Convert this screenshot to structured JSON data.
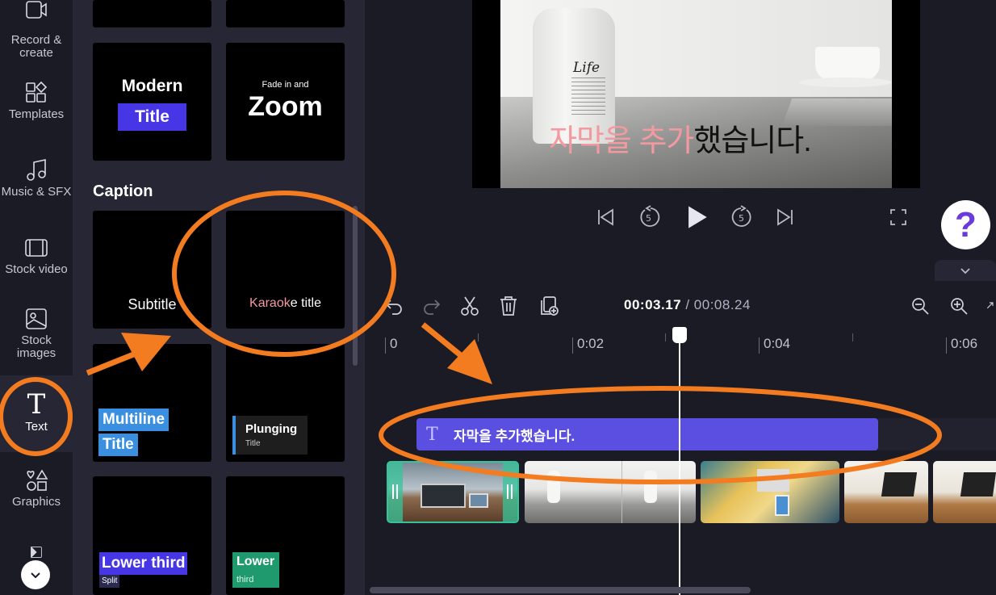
{
  "rail": {
    "items": [
      {
        "label": "Record &\ncreate",
        "icon": "record-icon"
      },
      {
        "label": "Templates",
        "icon": "templates-icon"
      },
      {
        "label": "Music & SFX",
        "icon": "music-icon"
      },
      {
        "label": "Stock video",
        "icon": "film-icon"
      },
      {
        "label": "Stock\nimages",
        "icon": "image-icon"
      },
      {
        "label": "Text",
        "icon": "text-icon"
      },
      {
        "label": "Graphics",
        "icon": "shapes-icon"
      }
    ]
  },
  "library": {
    "section_caption": "Caption",
    "cards": {
      "modern_title_1": "Modern",
      "modern_title_2": "Title",
      "zoom_small": "Fade in and",
      "zoom_big": "Zoom",
      "subtitle": "Subtitle",
      "karaoke_hl": "Karaok",
      "karaoke_rest": "e title",
      "multiline_1": "Multiline",
      "multiline_2": "Title",
      "plunging_1": "Plunging",
      "plunging_2": "Title",
      "lower_third_1": "Lower third",
      "lower_third_2": "Split",
      "lower_1": "Lower",
      "lower_2": "third"
    }
  },
  "preview": {
    "bottle_label": "Life",
    "caption_hl1": "자막을",
    "caption_mid1": " ",
    "caption_hl2": "추가",
    "caption_rest": "했습니다."
  },
  "timeline": {
    "current_time": "00:03.17",
    "separator": " / ",
    "total_time": "00:08.24",
    "ruler": [
      "0",
      "0:02",
      "0:04",
      "0:06"
    ],
    "text_clip_label": "자막을 추가했습니다."
  },
  "help_label": "?",
  "colors": {
    "accent": "#5a4fe0",
    "annotation": "#f47c20",
    "karaoke_highlight": "#f29aa0"
  }
}
